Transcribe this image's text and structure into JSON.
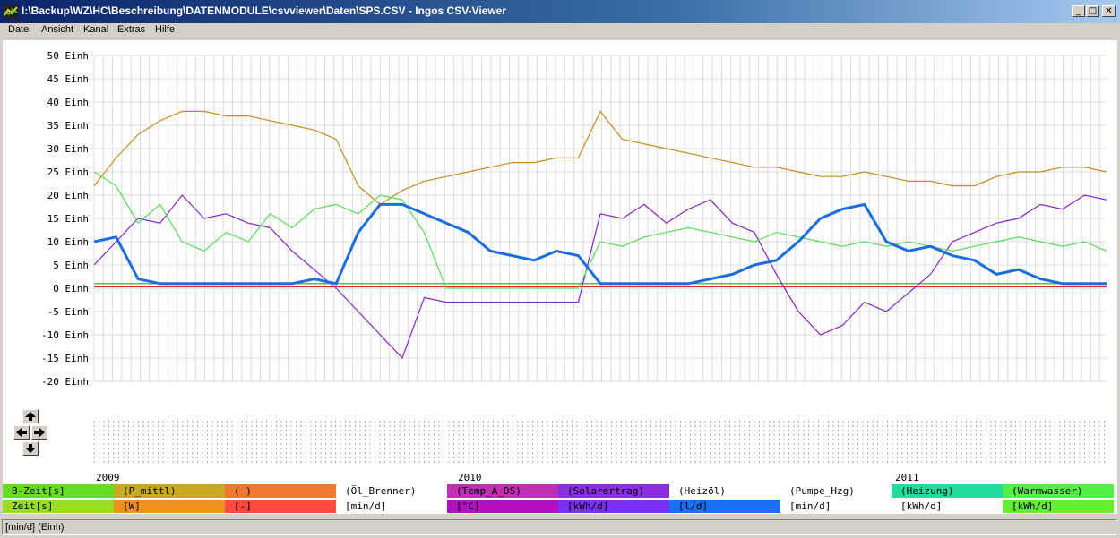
{
  "window": {
    "title": "I:\\Backup\\WZ\\HC\\Beschreibung\\DATENMODULE\\csvviewer\\Daten\\SPS.CSV - Ingos CSV-Viewer",
    "minimize": "_",
    "maximize": "□",
    "close": "✕"
  },
  "menu": [
    "Datei",
    "Ansicht",
    "Kanal",
    "Extras",
    "Hilfe"
  ],
  "chart_data": {
    "type": "line",
    "y_unit_label": "Einh",
    "ylim": [
      -20,
      50
    ],
    "yticks": [
      50,
      45,
      40,
      35,
      30,
      25,
      20,
      15,
      10,
      5,
      0,
      -5,
      -10,
      -15,
      -20
    ],
    "ytick_labels": [
      "50 Einh",
      "45 Einh",
      "40 Einh",
      "35 Einh",
      "30 Einh",
      "25 Einh",
      "20 Einh",
      "15 Einh",
      "10 Einh",
      "5 Einh",
      "0 Einh",
      "-5 Einh",
      "-10 Einh",
      "-15 Einh",
      "-20 Einh"
    ],
    "x_year_labels": [
      "2009",
      "2010",
      "2011"
    ],
    "grid": true,
    "series": [
      {
        "color": "#c88a1e",
        "values": [
          22,
          28,
          33,
          36,
          38,
          38,
          37,
          37,
          36,
          35,
          34,
          32,
          22,
          18,
          21,
          23,
          24,
          25,
          26,
          27,
          27,
          28,
          28,
          38,
          32,
          31,
          30,
          29,
          28,
          27,
          26,
          26,
          25,
          24,
          24,
          25,
          24,
          23,
          23,
          22,
          22,
          24,
          25,
          25,
          26,
          26,
          25
        ]
      },
      {
        "color": "#55dd55",
        "values": [
          25,
          22,
          14,
          18,
          10,
          8,
          12,
          10,
          16,
          13,
          17,
          18,
          16,
          20,
          19,
          12,
          0,
          0,
          0,
          0,
          0,
          0,
          0,
          10,
          9,
          11,
          12,
          13,
          12,
          11,
          10,
          12,
          11,
          10,
          9,
          10,
          9,
          10,
          9,
          8,
          9,
          10,
          11,
          10,
          9,
          10,
          8
        ]
      },
      {
        "color": "#8822cc",
        "values": [
          5,
          10,
          15,
          14,
          20,
          15,
          16,
          14,
          13,
          8,
          4,
          0,
          -5,
          -10,
          -15,
          -2,
          -3,
          -3,
          -3,
          -3,
          -3,
          -3,
          -3,
          16,
          15,
          18,
          14,
          17,
          19,
          14,
          12,
          3,
          -5,
          -10,
          -8,
          -3,
          -5,
          -1,
          3,
          10,
          12,
          14,
          15,
          18,
          17,
          20,
          19
        ]
      },
      {
        "color": "#1a6ee0",
        "values": [
          10,
          11,
          2,
          1,
          1,
          1,
          1,
          1,
          1,
          1,
          2,
          1,
          12,
          18,
          18,
          16,
          14,
          12,
          8,
          7,
          6,
          8,
          7,
          1,
          1,
          1,
          1,
          1,
          2,
          3,
          5,
          6,
          10,
          15,
          17,
          18,
          10,
          8,
          9,
          7,
          6,
          3,
          4,
          2,
          1,
          1,
          1
        ]
      },
      {
        "color": "#ee2222",
        "values": [
          0.3,
          0.3,
          0.3,
          0.3,
          0.3,
          0.3,
          0.3,
          0.3,
          0.3,
          0.3,
          0.3,
          0.3,
          0.3,
          0.3,
          0.3,
          0.3,
          0.3,
          0.3,
          0.3,
          0.3,
          0.3,
          0.3,
          0.3,
          0.3,
          0.3,
          0.3,
          0.3,
          0.3,
          0.3,
          0.3,
          0.3,
          0.3,
          0.3,
          0.3,
          0.3,
          0.3,
          0.3,
          0.3,
          0.3,
          0.3,
          0.3,
          0.3,
          0.3,
          0.3,
          0.3,
          0.3,
          0.3
        ]
      },
      {
        "color": "#22aa22",
        "values": [
          1,
          1,
          1,
          1,
          1,
          1,
          1,
          1,
          1,
          1,
          1,
          1,
          1,
          1,
          1,
          1,
          1,
          1,
          1,
          1,
          1,
          1,
          1,
          1,
          1,
          1,
          1,
          1,
          1,
          1,
          1,
          1,
          1,
          1,
          1,
          1,
          1,
          1,
          1,
          1,
          1,
          1,
          1,
          1,
          1,
          1,
          1
        ]
      }
    ]
  },
  "legend": {
    "names": [
      {
        "text": "B-Zeit[s]",
        "color": "#66dd22"
      },
      {
        "text": "(P_mittl)",
        "color": "#c8aa22"
      },
      {
        "text": "(            )",
        "color": "#f07830"
      },
      {
        "text": "(Öl_Brenner)",
        "color": "#ffffff"
      },
      {
        "text": "(Temp_A_DS)",
        "color": "#c030b0"
      },
      {
        "text": "(Solarertrag)",
        "color": "#8a30e0"
      },
      {
        "text": "(Heizöl)",
        "color": "#ffffff"
      },
      {
        "text": "(Pumpe_Hzg)",
        "color": "#ffffff"
      },
      {
        "text": "(Heizung)",
        "color": "#22dda0"
      },
      {
        "text": "(Warmwasser)",
        "color": "#55ee44"
      }
    ],
    "units": [
      {
        "text": "Zeit[s]",
        "color": "#99dd22"
      },
      {
        "text": "[W]",
        "color": "#ee9020"
      },
      {
        "text": "[-]",
        "color": "#ff4a40"
      },
      {
        "text": "[min/d]",
        "color": "#ffffff"
      },
      {
        "text": "[°C]",
        "color": "#b010c0"
      },
      {
        "text": "[kWh/d]",
        "color": "#7a30f0"
      },
      {
        "text": "[l/d]",
        "color": "#1a70f0"
      },
      {
        "text": "[min/d]",
        "color": "#ffffff"
      },
      {
        "text": "[kWh/d]",
        "color": "#ffffff"
      },
      {
        "text": "[kWh/d]",
        "color": "#66ee33"
      }
    ]
  },
  "status": {
    "text": "[min/d] (Einh)"
  }
}
